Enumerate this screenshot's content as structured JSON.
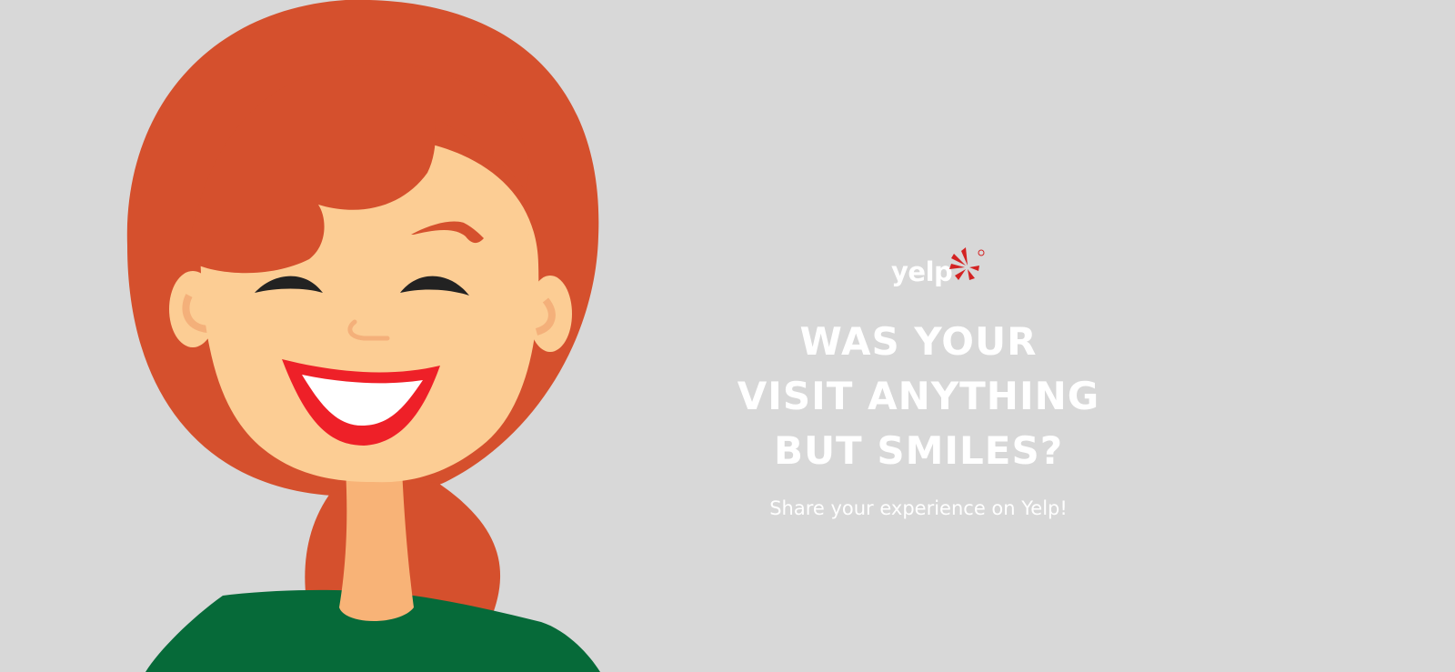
{
  "logo": {
    "text": "yelp",
    "icon": "yelp-burst-icon",
    "color": "#d32323"
  },
  "headline": {
    "line1": "WAS YOUR",
    "line2": "VISIT ANYTHING",
    "line3": "BUT SMILES?"
  },
  "subtext": "Share your experience on Yelp!",
  "illustration": {
    "icon": "smiling-woman-illustration",
    "hair_color": "#d5502d",
    "skin_color": "#fccd94",
    "shirt_color": "#066a39"
  },
  "colors": {
    "background": "#d8d8d8",
    "text": "#ffffff",
    "lips": "#ee2028"
  }
}
